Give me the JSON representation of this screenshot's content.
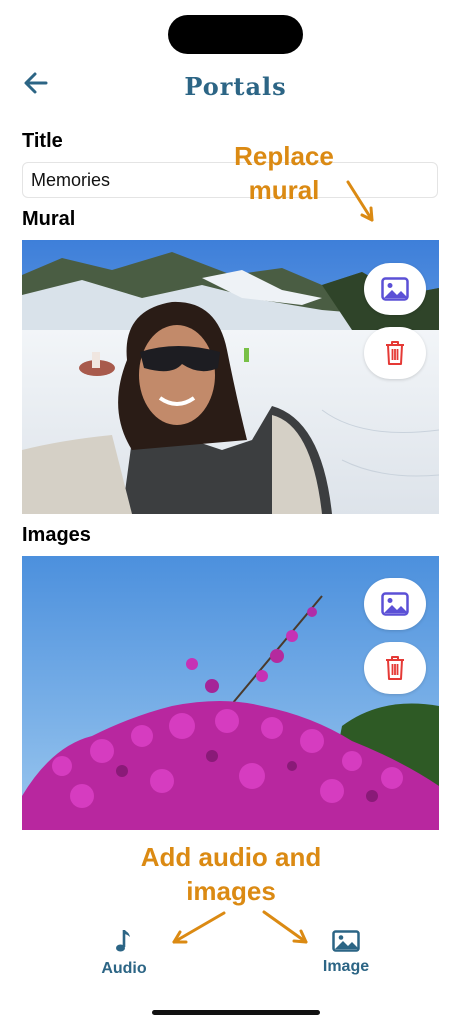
{
  "header": {
    "title": "Portals"
  },
  "form": {
    "title_label": "Title",
    "title_value": "Memories",
    "mural_label": "Mural",
    "images_label": "Images"
  },
  "annotations": {
    "replace_mural": "Replace mural",
    "add_audio_images": "Add audio and images"
  },
  "tabbar": {
    "audio_label": "Audio",
    "image_label": "Image"
  },
  "colors": {
    "accent": "#2c6585",
    "annotation": "#db8a13",
    "image_icon": "#5b50d6",
    "trash_icon": "#e53935"
  },
  "icons": [
    "back-arrow-icon",
    "image-icon",
    "trash-icon",
    "music-note-icon"
  ]
}
